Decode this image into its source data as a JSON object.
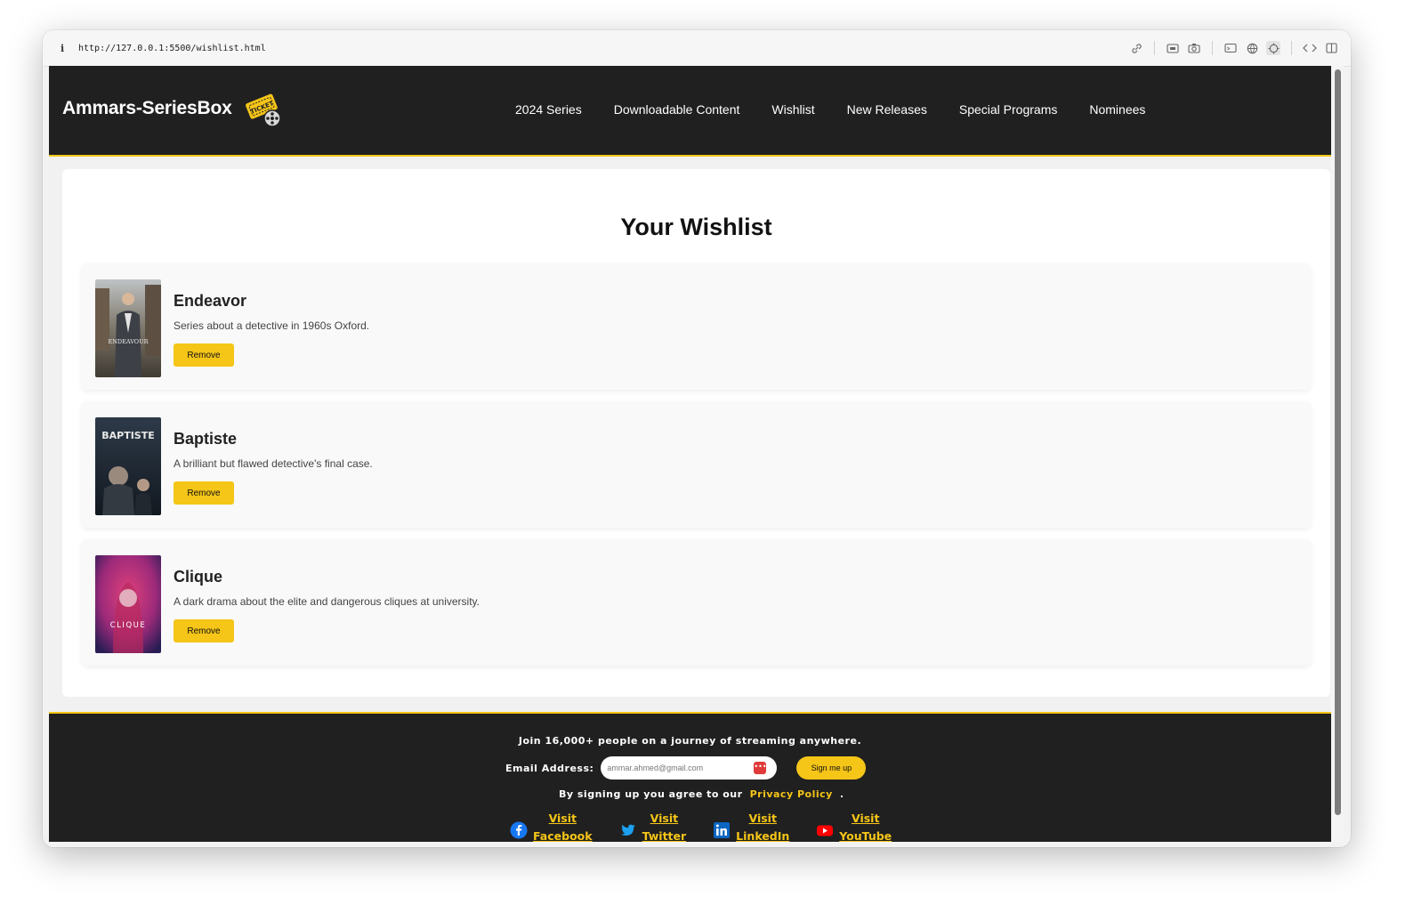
{
  "browser": {
    "url": "http://127.0.0.1:5500/wishlist.html"
  },
  "header": {
    "logo_text": "Ammars-SeriesBox",
    "logo_icon": "ticket-film-reel-icon",
    "nav": [
      "2024 Series",
      "Downloadable Content",
      "Wishlist",
      "New Releases",
      "Special Programs",
      "Nominees"
    ]
  },
  "main": {
    "title": "Your Wishlist",
    "items": [
      {
        "title": "Endeavor",
        "description": "Series about a detective in 1960s Oxford.",
        "button": "Remove",
        "poster_text": "ENDEAVOUR"
      },
      {
        "title": "Baptiste",
        "description": "A brilliant but flawed detective's final case.",
        "button": "Remove",
        "poster_text": "BAPTISTE"
      },
      {
        "title": "Clique",
        "description": "A dark drama about the elite and dangerous cliques at university.",
        "button": "Remove",
        "poster_text": "CLIQUE"
      }
    ]
  },
  "footer": {
    "join_text": "Join 16,000+ people on a journey of streaming anywhere.",
    "email_label": "Email Address:",
    "email_value": "ammar.ahmed@gmail.com",
    "signup_button": "Sign me up",
    "agree_text": "By signing up you agree to our",
    "privacy_link": "Privacy Policy",
    "agree_end": ".",
    "socials": [
      {
        "line1": "Visit",
        "line2": "Facebook",
        "icon": "facebook-icon"
      },
      {
        "line1": "Visit",
        "line2": "Twitter",
        "icon": "twitter-icon"
      },
      {
        "line1": "Visit",
        "line2": "LinkedIn",
        "icon": "linkedin-icon"
      },
      {
        "line1": "Visit",
        "line2": "YouTube",
        "icon": "youtube-icon"
      }
    ]
  },
  "colors": {
    "accent": "#f5c518",
    "header_bg": "#202020",
    "page_bg": "#f1f1f1"
  }
}
